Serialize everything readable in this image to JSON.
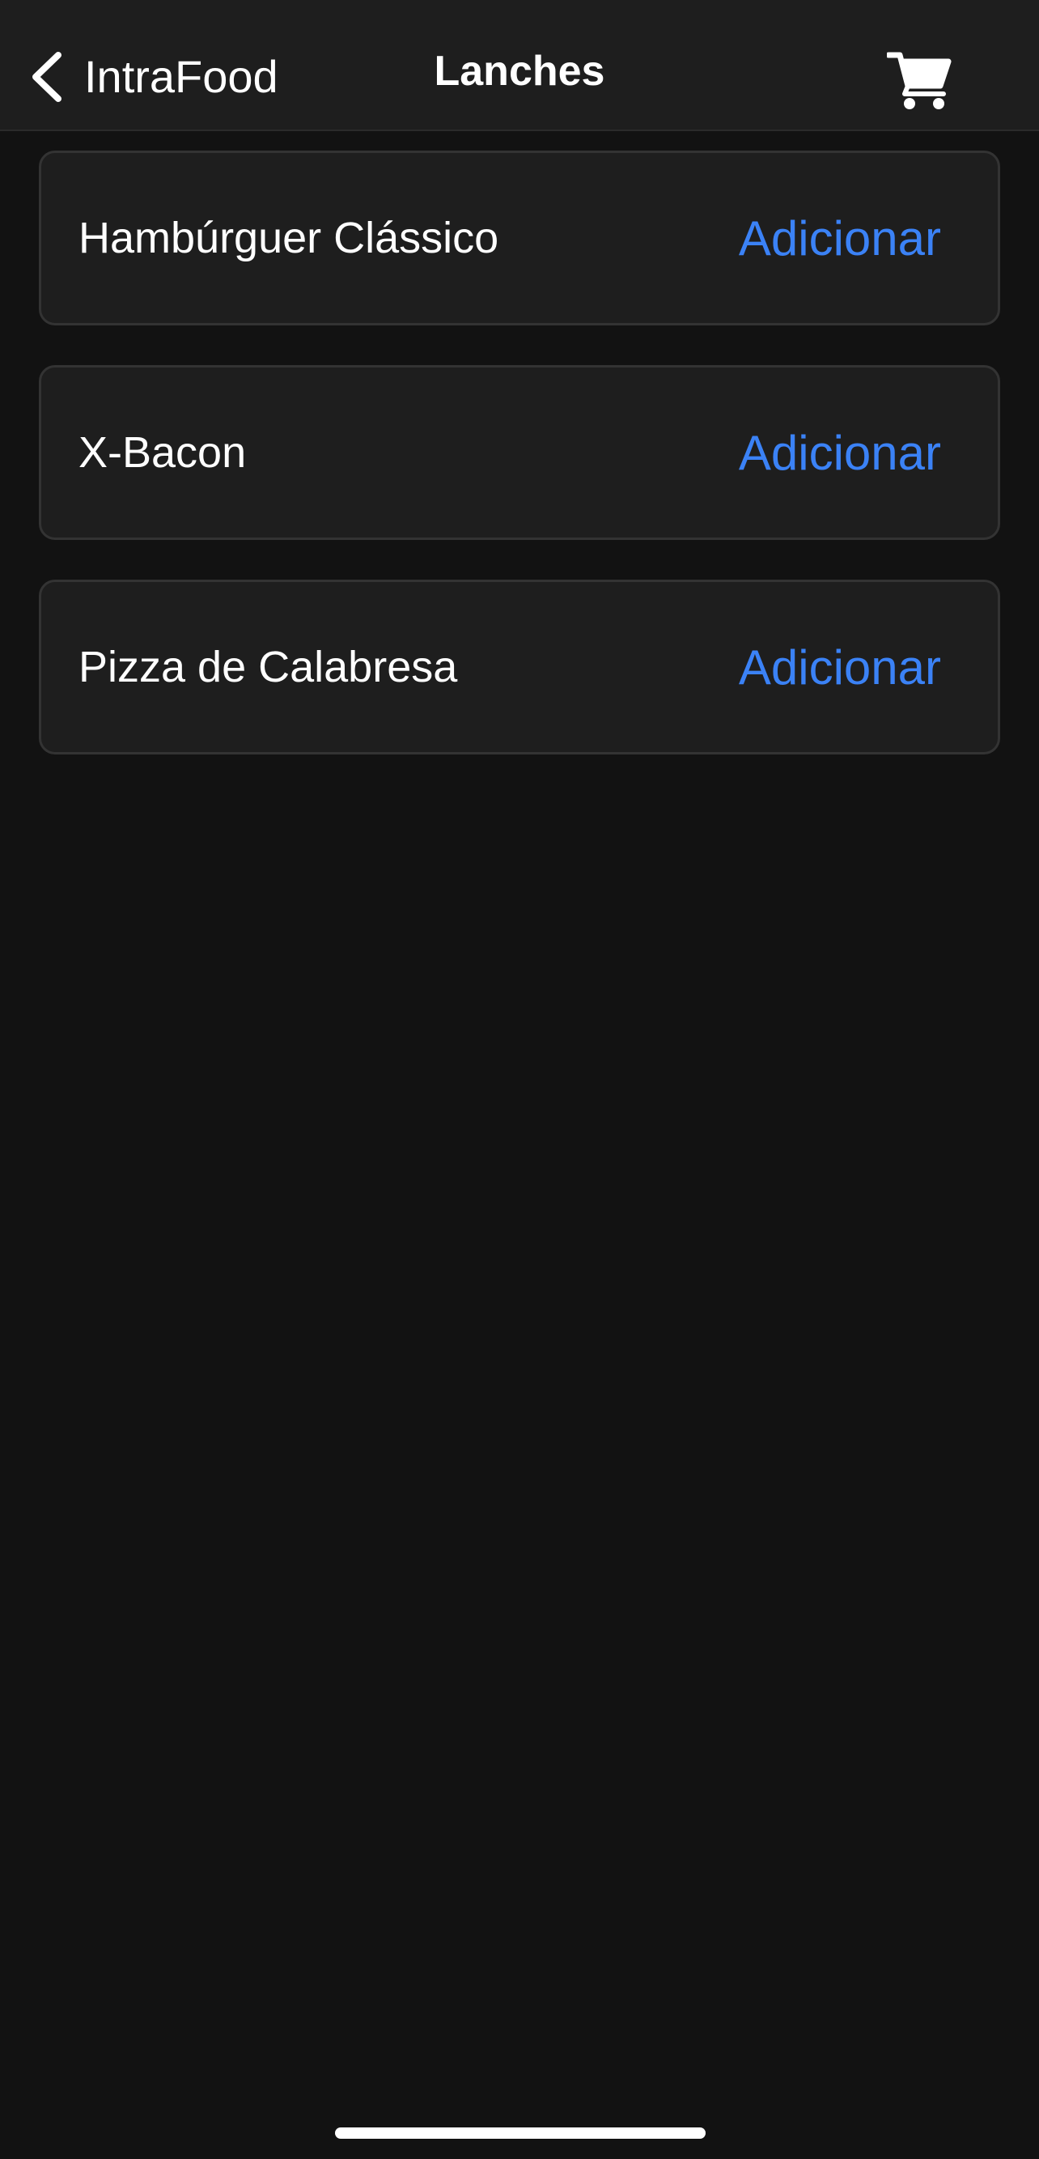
{
  "nav": {
    "back_label": "IntraFood",
    "title": "Lanches",
    "back_icon": "chevron-left-icon",
    "cart_icon": "cart-icon"
  },
  "items": [
    {
      "name": "Hambúrguer Clássico",
      "action_label": "Adicionar"
    },
    {
      "name": "X-Bacon",
      "action_label": "Adicionar"
    },
    {
      "name": "Pizza de Calabresa",
      "action_label": "Adicionar"
    }
  ],
  "colors": {
    "background": "#121212",
    "card": "#1e1e1e",
    "accent": "#3b82f6",
    "text": "#ffffff"
  }
}
